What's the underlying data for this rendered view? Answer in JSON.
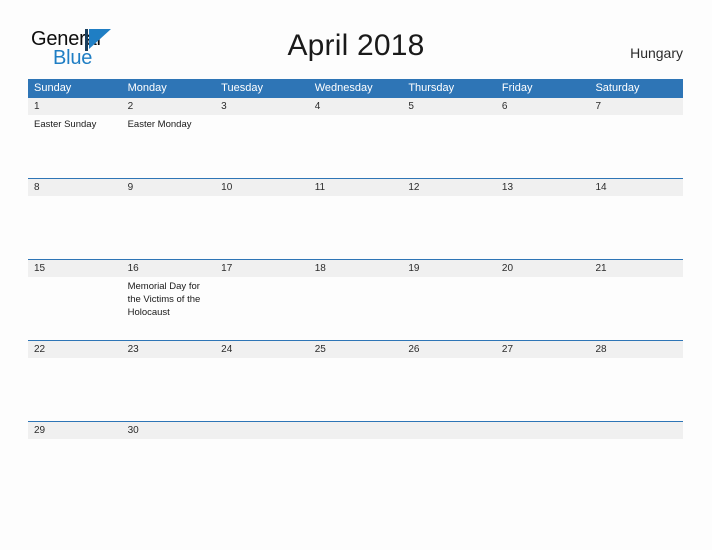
{
  "branding": {
    "logo_general": "General",
    "logo_blue": "Blue",
    "logo_mark": "triangle-mark"
  },
  "header": {
    "title": "April 2018",
    "country": "Hungary"
  },
  "colors": {
    "header_blue": "#2e75b6",
    "band_gray": "#f0f0f0",
    "logo_blue": "#1f7ec4",
    "page_background": "#fdfdfd",
    "text": "#1a1a1a"
  },
  "calendar": {
    "weekdays": [
      "Sunday",
      "Monday",
      "Tuesday",
      "Wednesday",
      "Thursday",
      "Friday",
      "Saturday"
    ],
    "weeks": [
      {
        "days": [
          {
            "date": "1",
            "event": "Easter Sunday"
          },
          {
            "date": "2",
            "event": "Easter Monday"
          },
          {
            "date": "3",
            "event": ""
          },
          {
            "date": "4",
            "event": ""
          },
          {
            "date": "5",
            "event": ""
          },
          {
            "date": "6",
            "event": ""
          },
          {
            "date": "7",
            "event": ""
          }
        ]
      },
      {
        "days": [
          {
            "date": "8",
            "event": ""
          },
          {
            "date": "9",
            "event": ""
          },
          {
            "date": "10",
            "event": ""
          },
          {
            "date": "11",
            "event": ""
          },
          {
            "date": "12",
            "event": ""
          },
          {
            "date": "13",
            "event": ""
          },
          {
            "date": "14",
            "event": ""
          }
        ]
      },
      {
        "days": [
          {
            "date": "15",
            "event": ""
          },
          {
            "date": "16",
            "event": "Memorial Day for the Victims of the Holocaust"
          },
          {
            "date": "17",
            "event": ""
          },
          {
            "date": "18",
            "event": ""
          },
          {
            "date": "19",
            "event": ""
          },
          {
            "date": "20",
            "event": ""
          },
          {
            "date": "21",
            "event": ""
          }
        ]
      },
      {
        "days": [
          {
            "date": "22",
            "event": ""
          },
          {
            "date": "23",
            "event": ""
          },
          {
            "date": "24",
            "event": ""
          },
          {
            "date": "25",
            "event": ""
          },
          {
            "date": "26",
            "event": ""
          },
          {
            "date": "27",
            "event": ""
          },
          {
            "date": "28",
            "event": ""
          }
        ]
      },
      {
        "days": [
          {
            "date": "29",
            "event": ""
          },
          {
            "date": "30",
            "event": ""
          },
          {
            "date": "",
            "event": ""
          },
          {
            "date": "",
            "event": ""
          },
          {
            "date": "",
            "event": ""
          },
          {
            "date": "",
            "event": ""
          },
          {
            "date": "",
            "event": ""
          }
        ]
      }
    ]
  }
}
